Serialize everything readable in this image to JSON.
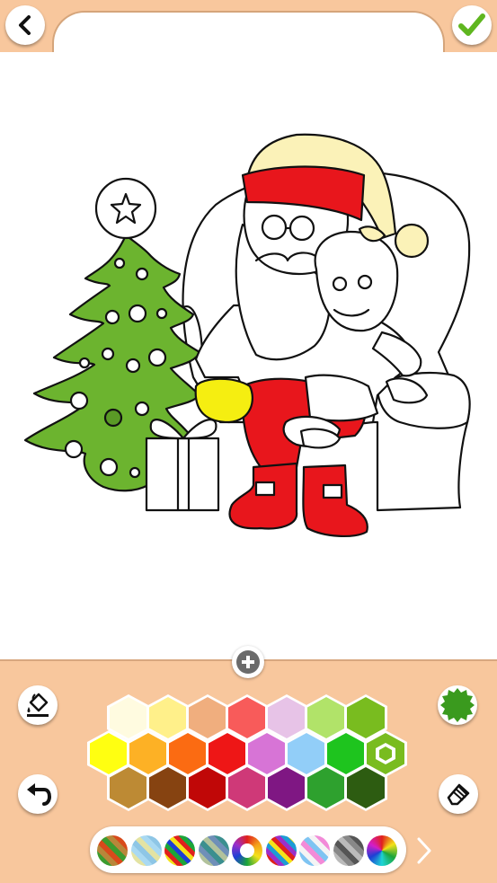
{
  "toolbar": {
    "back_icon": "chevron-left-icon",
    "confirm_icon": "checkmark-icon",
    "accent": "#f8c79d"
  },
  "tools": {
    "fill_icon": "paint-bucket-icon",
    "undo_icon": "undo-arrow-icon",
    "brush_size_icon": "gear-hex-icon",
    "eraser_icon": "eraser-icon",
    "zoom_icon": "plus-icon",
    "next_icon": "chevron-right-icon"
  },
  "palette": {
    "selected": "#79bc1f",
    "row1": [
      "#fffbe0",
      "#fff08a",
      "#f0ae7e",
      "#f85b5a",
      "#e7c3e7",
      "#b1e369",
      "#79bc1f"
    ],
    "row2": [
      "#ffff11",
      "#fdb125",
      "#fb6b12",
      "#ee1616",
      "#d774d6",
      "#92cef8",
      "#1ec41e",
      "#79bc1f"
    ],
    "row3": [
      "#bd8a34",
      "#864311",
      "#c00707",
      "#cf3978",
      "#7f1783",
      "#2ea12e",
      "#2d5c11"
    ]
  },
  "swatch_bar": {
    "swatches": [
      "multicolor-warm",
      "multicolor-pastel",
      "rainbow-stripes",
      "gray-teal-stripes",
      "rainbow-ring",
      "rainbow-diagonal",
      "pink-blue-stripes",
      "gray-stripes",
      "rainbow-wheel"
    ],
    "selected_index": 4
  }
}
